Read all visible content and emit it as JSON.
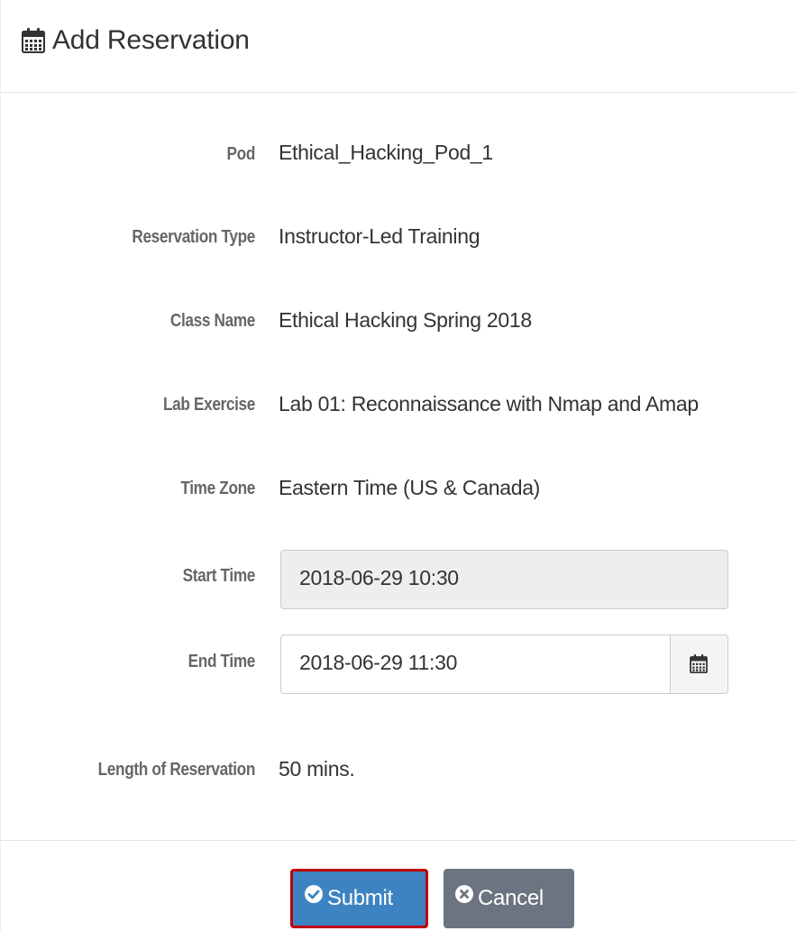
{
  "header": {
    "icon": "calendar-icon",
    "title": "Add Reservation"
  },
  "fields": {
    "pod": {
      "label": "Pod",
      "value": "Ethical_Hacking_Pod_1"
    },
    "reservation_type": {
      "label": "Reservation Type",
      "value": "Instructor-Led Training"
    },
    "class_name": {
      "label": "Class Name",
      "value": "Ethical Hacking Spring 2018"
    },
    "lab_exercise": {
      "label": "Lab Exercise",
      "value": "Lab 01: Reconnaissance with Nmap and Amap"
    },
    "time_zone": {
      "label": "Time Zone",
      "value": "Eastern Time (US & Canada)"
    },
    "start_time": {
      "label": "Start Time",
      "value": "2018-06-29 10:30"
    },
    "end_time": {
      "label": "End Time",
      "value": "2018-06-29 11:30",
      "addon_icon": "calendar-icon"
    },
    "length": {
      "label": "Length of Reservation",
      "value": "50 mins."
    }
  },
  "footer": {
    "submit_label": "Submit",
    "submit_icon": "check-circle-icon",
    "cancel_label": "Cancel",
    "cancel_icon": "times-circle-icon"
  },
  "colors": {
    "submit_bg": "#3d83c2",
    "submit_outline": "#c00000",
    "cancel_bg": "#6b7480",
    "disabled_input_bg": "#eeeeee"
  }
}
